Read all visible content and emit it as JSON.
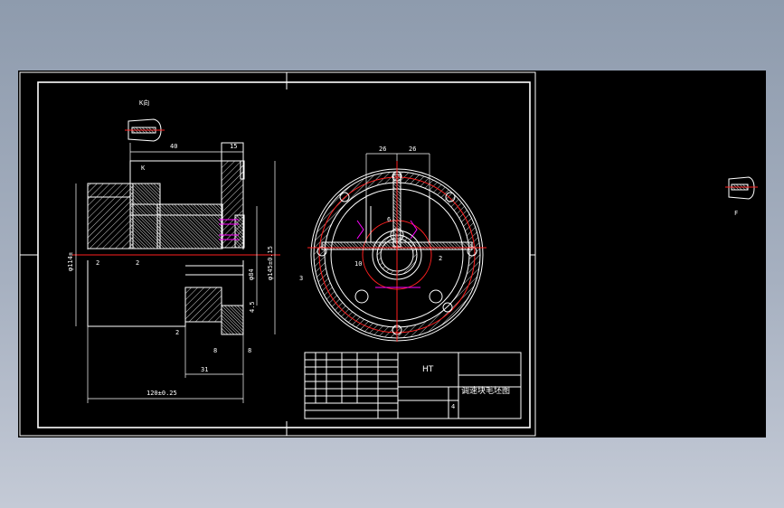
{
  "colors": {
    "background": "#000000",
    "line": "#ffffff",
    "center_line": "#ff2020",
    "hidden": "#ff00ff"
  },
  "view_labels": {
    "detail_k_top": "K向",
    "detail_k_right": "F"
  },
  "dimensions_section": {
    "d40": "40",
    "d15": "15",
    "dk": "K",
    "d2a": "2",
    "d2b": "2",
    "d114": "φ114±",
    "d84": "φ84",
    "d145": "φ145±0.15",
    "d4_5": "4.5",
    "d2c": "2",
    "d8a": "8",
    "d8b": "8",
    "d31": "31",
    "d120": "120±0.25"
  },
  "dimensions_round": {
    "d26a": "26",
    "d26b": "26",
    "d6": "6",
    "d10": "10",
    "d2": "2",
    "d3": "3"
  },
  "title_block": {
    "part_name": "调速块毛坯图",
    "sheet": "4",
    "material": "HT"
  }
}
